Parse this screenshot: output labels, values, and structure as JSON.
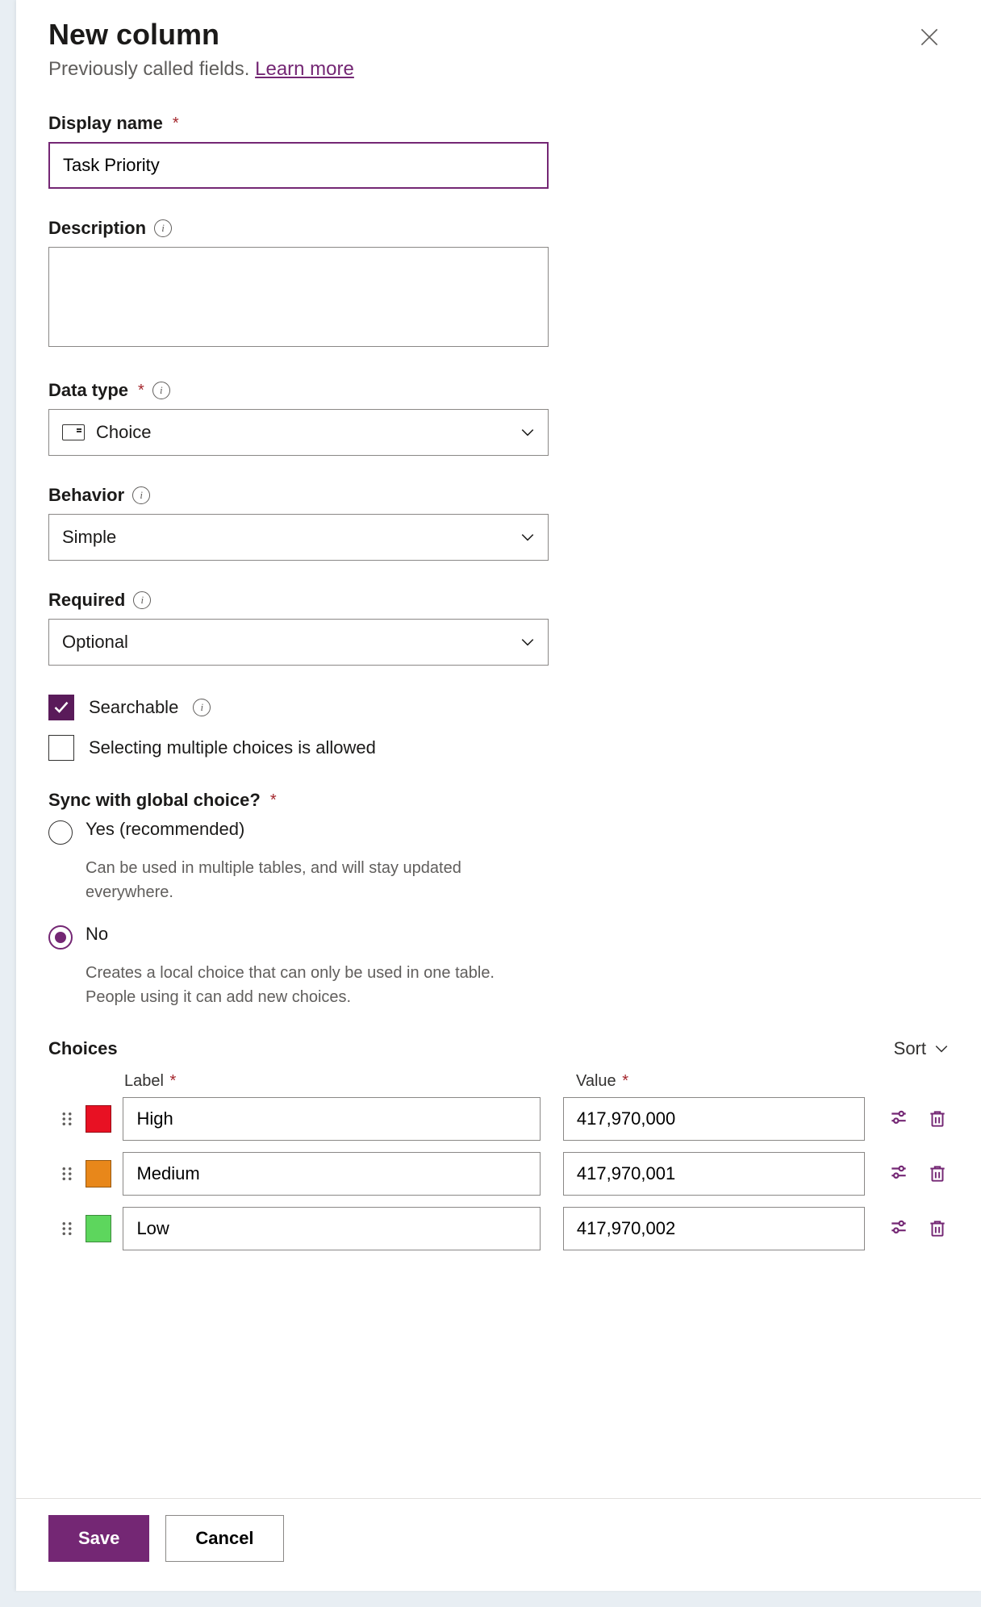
{
  "header": {
    "title": "New column",
    "subtitle_text": "Previously called fields.",
    "learn_more": "Learn more"
  },
  "fields": {
    "display_name": {
      "label": "Display name",
      "value": "Task Priority"
    },
    "description": {
      "label": "Description",
      "value": ""
    },
    "data_type": {
      "label": "Data type",
      "value": "Choice"
    },
    "behavior": {
      "label": "Behavior",
      "value": "Simple"
    },
    "required": {
      "label": "Required",
      "value": "Optional"
    },
    "searchable": {
      "label": "Searchable",
      "checked": true
    },
    "multiselect": {
      "label": "Selecting multiple choices is allowed",
      "checked": false
    }
  },
  "sync": {
    "label": "Sync with global choice?",
    "selected": "no",
    "yes": {
      "label": "Yes (recommended)",
      "desc": "Can be used in multiple tables, and will stay updated everywhere."
    },
    "no": {
      "label": "No",
      "desc": "Creates a local choice that can only be used in one table. People using it can add new choices."
    }
  },
  "choices": {
    "section_label": "Choices",
    "sort_label": "Sort",
    "col_label": "Label",
    "col_value": "Value",
    "rows": [
      {
        "color": "#e81123",
        "label": "High",
        "value": "417,970,000"
      },
      {
        "color": "#e8871a",
        "label": "Medium",
        "value": "417,970,001"
      },
      {
        "color": "#5dd65d",
        "label": "Low",
        "value": "417,970,002"
      }
    ]
  },
  "footer": {
    "save": "Save",
    "cancel": "Cancel"
  }
}
